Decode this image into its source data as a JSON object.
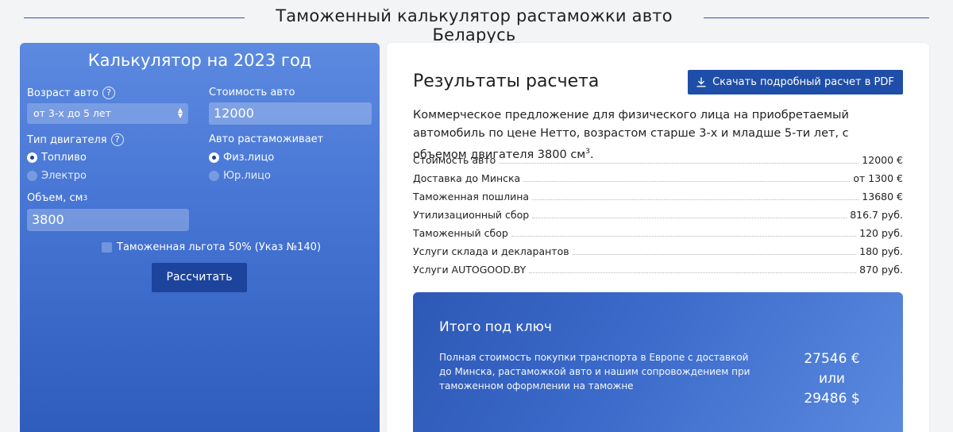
{
  "header": {
    "title": "Таможенный калькулятор растаможки авто Беларусь"
  },
  "calculator": {
    "title": "Калькулятор на 2023 год",
    "age_label": "Возраст авто",
    "age_value": "от 3-х до 5 лет",
    "price_label": "Стоимость авто",
    "price_value": "12000",
    "engine_type_label": "Тип двигателя",
    "engine_options": [
      "Топливо",
      "Электро"
    ],
    "engine_selected": "Топливо",
    "clearance_label": "Авто растаможивает",
    "clearance_options": [
      "Физ.лицо",
      "Юр.лицо"
    ],
    "clearance_selected": "Физ.лицо",
    "volume_label": "Объем, см",
    "volume_sup": "3",
    "volume_value": "3800",
    "benefit_label": "Таможенная льгота 50% (Указ №140)",
    "benefit_checked": false,
    "calc_button": "Рассчитать",
    "help_glyph": "?"
  },
  "results": {
    "title": "Результаты расчета",
    "pdf_button": "Скачать подробный расчет в PDF",
    "offer_text": "Коммерческое предложение для физического лица на приобретаемый автомобиль по цене Нетто, возрастом старше 3-х и младше 5-ти лет, с объемом двигателя 3800 см",
    "offer_sup": "3",
    "offer_end": ".",
    "rows": [
      {
        "label": "Стоимость авто",
        "value": "12000 €"
      },
      {
        "label": "Доставка до Минска",
        "value": "от 1300 €"
      },
      {
        "label": "Таможенная пошлина",
        "value": "13680 €"
      },
      {
        "label": "Утилизационный сбор",
        "value": "816.7 руб."
      },
      {
        "label": "Таможенный сбор",
        "value": "120 руб."
      },
      {
        "label": "Услуги склада и декларантов",
        "value": "180 руб."
      },
      {
        "label": "Услуги AUTOGOOD.BY",
        "value": "870 руб."
      }
    ],
    "total": {
      "title": "Итого под ключ",
      "description": "Полная стоимость покупки транспорта в Европе с доставкой до Минска, растаможкой авто и нашим сопровождением при таможенном оформлении на таможне",
      "amount_eur": "27546 €",
      "or": "или",
      "amount_usd": "29486 $"
    }
  },
  "colors": {
    "accent": "#1f4ea8",
    "panel_gradient_top": "#5c8ae0",
    "panel_gradient_bottom": "#2f5cbc"
  }
}
